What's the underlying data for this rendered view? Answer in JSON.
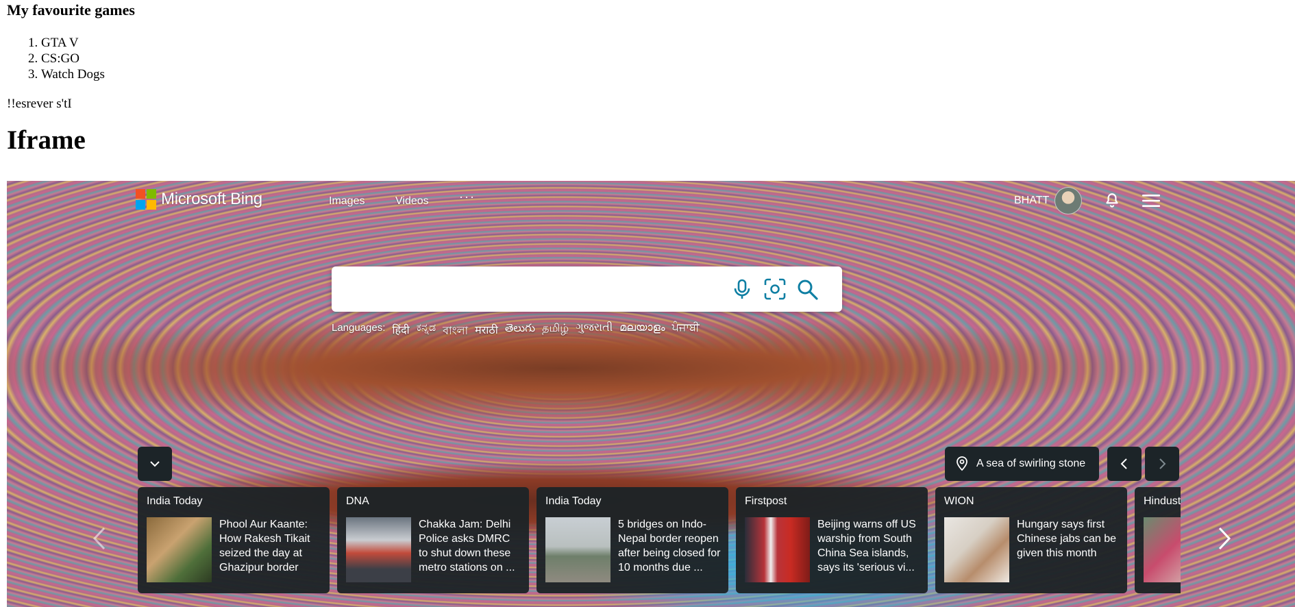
{
  "page": {
    "fav_heading": "My favourite games",
    "games": [
      "GTA V",
      "CS:GO",
      "Watch Dogs"
    ],
    "reversed_text": "!!esrever s'tI",
    "iframe_heading": "Iframe"
  },
  "bing": {
    "logo_text": "Microsoft Bing",
    "nav": {
      "images": "Images",
      "videos": "Videos",
      "more": "···"
    },
    "user_name": "BHATT",
    "search": {
      "value": "",
      "placeholder": ""
    },
    "languages_label": "Languages:",
    "languages": [
      "हिंदी",
      "ಕನ್ನಡ",
      "বাংলা",
      "मराठी",
      "తెలుగు",
      "தமிழ்",
      "ગુજરાતી",
      "മലയാളം",
      "ਪੰਜਾਬੀ"
    ],
    "image_caption": "A sea of swirling stone",
    "news": [
      {
        "source": "India Today",
        "headline": "Phool Aur Kaante: How Rakesh Tikait seized the day at Ghazipur border"
      },
      {
        "source": "DNA",
        "headline": "Chakka Jam: Delhi Police asks DMRC to shut down these metro stations on ..."
      },
      {
        "source": "India Today",
        "headline": "5 bridges on Indo-Nepal border reopen after being closed for 10 months due ..."
      },
      {
        "source": "Firstpost",
        "headline": "Beijing warns off US warship from South China Sea islands, says its 'serious vi..."
      },
      {
        "source": "WION",
        "headline": "Hungary says first Chinese jabs can be given this month"
      },
      {
        "source": "Hindust",
        "headline": ""
      }
    ],
    "colors": {
      "accent": "#0f7fa3",
      "card_bg": "#1d2327"
    },
    "icons": {
      "mic": "microphone-icon",
      "visual": "visual-search-icon",
      "search": "search-icon",
      "bell": "bell-icon",
      "menu": "hamburger-menu-icon",
      "pin": "location-pin-icon"
    }
  }
}
